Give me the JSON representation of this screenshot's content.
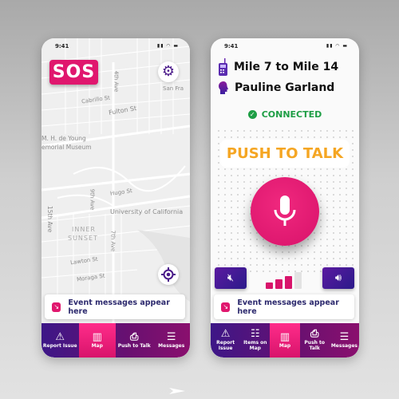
{
  "colors": {
    "brand_pink": "#e0176e",
    "nav_purple": "#3d1787",
    "ptt_orange": "#f5a623",
    "connected_green": "#1e9e45",
    "text_navy": "#2d2a6e"
  },
  "status_bar": {
    "time": "9:41",
    "icons": [
      "signal-icon",
      "wifi-icon",
      "battery-icon"
    ]
  },
  "map_screen": {
    "sos_label": "SOS",
    "map_labels": {
      "ave1": "7th Ave",
      "ave2": "4th Ave",
      "cabrillo": "Cabrillo St",
      "fulton": "Fulton St",
      "museum1": "M. H. de Young",
      "museum2": "emorial Museum",
      "hugo": "Hugo St",
      "ninth": "9th Ave",
      "fifteenth": "15th Ave",
      "ucsf": "University of California",
      "inner1": "INNER",
      "inner2": "SUNSET",
      "seventh": "7th Ave",
      "lawton": "Lawton St",
      "moraga": "Moraga St",
      "usf": "San Fra"
    },
    "event_text": "Event messages appear here",
    "nav": [
      {
        "label": "Report Issue",
        "icon": "warning-icon"
      },
      {
        "label": "Map",
        "icon": "map-icon",
        "active": true
      },
      {
        "label": "Push to Talk",
        "icon": "ptt-icon"
      },
      {
        "label": "Messages",
        "icon": "messages-icon"
      }
    ]
  },
  "ptt_screen": {
    "channel": "Mile 7 to Mile 14",
    "user": "Pauline Garland",
    "connection_status": "CONNECTED",
    "ptt_label": "PUSH TO TALK",
    "signal_level": "3/4",
    "event_text": "Event messages appear here",
    "nav": [
      {
        "label": "Report Issue",
        "icon": "warning-icon"
      },
      {
        "label": "Items on Map",
        "icon": "list-icon"
      },
      {
        "label": "Map",
        "icon": "map-icon",
        "active": true
      },
      {
        "label": "Push to Talk",
        "icon": "ptt-icon"
      },
      {
        "label": "Messages",
        "icon": "messages-icon"
      }
    ]
  }
}
